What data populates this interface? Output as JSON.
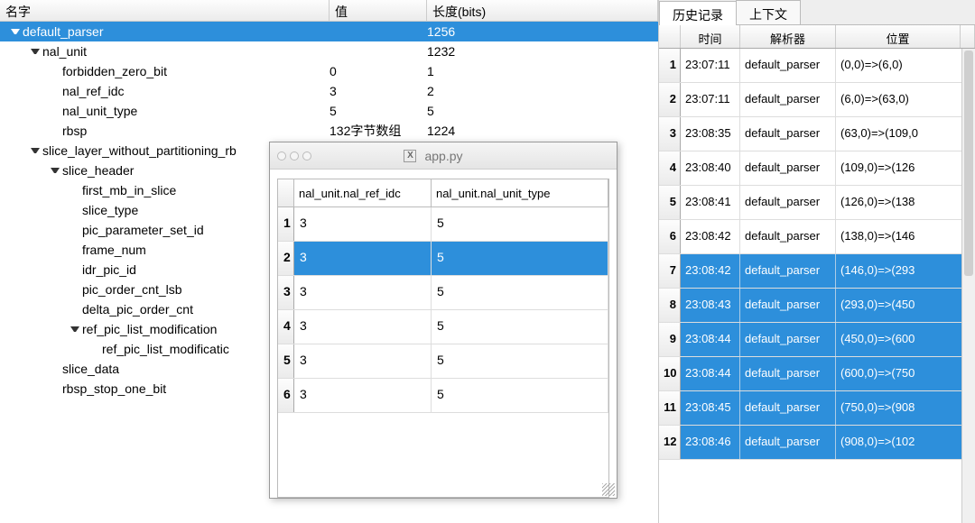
{
  "main_headers": {
    "name": "名字",
    "value": "值",
    "length": "长度(bits)"
  },
  "tree": [
    {
      "indent": 0,
      "arrow": "down",
      "name": "default_parser",
      "value": "",
      "length": "1256",
      "selected": true
    },
    {
      "indent": 1,
      "arrow": "down",
      "name": "nal_unit",
      "value": "",
      "length": "1232"
    },
    {
      "indent": 2,
      "arrow": "",
      "name": "forbidden_zero_bit",
      "value": "0",
      "length": "1"
    },
    {
      "indent": 2,
      "arrow": "",
      "name": "nal_ref_idc",
      "value": "3",
      "length": "2"
    },
    {
      "indent": 2,
      "arrow": "",
      "name": "nal_unit_type",
      "value": "5",
      "length": "5"
    },
    {
      "indent": 2,
      "arrow": "",
      "name": "rbsp",
      "value": "132字节数组",
      "length": "1224"
    },
    {
      "indent": 1,
      "arrow": "down",
      "name": "slice_layer_without_partitioning_rb",
      "value": "",
      "length": ""
    },
    {
      "indent": 2,
      "arrow": "down",
      "name": "slice_header",
      "value": "",
      "length": ""
    },
    {
      "indent": 3,
      "arrow": "",
      "name": "first_mb_in_slice",
      "value": "",
      "length": ""
    },
    {
      "indent": 3,
      "arrow": "",
      "name": "slice_type",
      "value": "",
      "length": ""
    },
    {
      "indent": 3,
      "arrow": "",
      "name": "pic_parameter_set_id",
      "value": "",
      "length": ""
    },
    {
      "indent": 3,
      "arrow": "",
      "name": "frame_num",
      "value": "",
      "length": ""
    },
    {
      "indent": 3,
      "arrow": "",
      "name": "idr_pic_id",
      "value": "",
      "length": ""
    },
    {
      "indent": 3,
      "arrow": "",
      "name": "pic_order_cnt_lsb",
      "value": "",
      "length": ""
    },
    {
      "indent": 3,
      "arrow": "",
      "name": "delta_pic_order_cnt",
      "value": "",
      "length": ""
    },
    {
      "indent": 3,
      "arrow": "down",
      "name": "ref_pic_list_modification",
      "value": "",
      "length": ""
    },
    {
      "indent": 4,
      "arrow": "",
      "name": "ref_pic_list_modificatic",
      "value": "",
      "length": ""
    },
    {
      "indent": 2,
      "arrow": "",
      "name": "slice_data",
      "value": "",
      "length": ""
    },
    {
      "indent": 2,
      "arrow": "",
      "name": "rbsp_stop_one_bit",
      "value": "",
      "length": ""
    }
  ],
  "tabs": {
    "history": "历史记录",
    "context": "上下文"
  },
  "hist_headers": {
    "time": "时间",
    "parser": "解析器",
    "position": "位置"
  },
  "history": [
    {
      "idx": "1",
      "time": "23:07:11",
      "parser": "default_parser",
      "pos": "(0,0)=>(6,0)",
      "selected": false
    },
    {
      "idx": "2",
      "time": "23:07:11",
      "parser": "default_parser",
      "pos": "(6,0)=>(63,0)",
      "selected": false
    },
    {
      "idx": "3",
      "time": "23:08:35",
      "parser": "default_parser",
      "pos": "(63,0)=>(109,0",
      "selected": false
    },
    {
      "idx": "4",
      "time": "23:08:40",
      "parser": "default_parser",
      "pos": "(109,0)=>(126",
      "selected": false
    },
    {
      "idx": "5",
      "time": "23:08:41",
      "parser": "default_parser",
      "pos": "(126,0)=>(138",
      "selected": false
    },
    {
      "idx": "6",
      "time": "23:08:42",
      "parser": "default_parser",
      "pos": "(138,0)=>(146",
      "selected": false
    },
    {
      "idx": "7",
      "time": "23:08:42",
      "parser": "default_parser",
      "pos": "(146,0)=>(293",
      "selected": true
    },
    {
      "idx": "8",
      "time": "23:08:43",
      "parser": "default_parser",
      "pos": "(293,0)=>(450",
      "selected": true
    },
    {
      "idx": "9",
      "time": "23:08:44",
      "parser": "default_parser",
      "pos": "(450,0)=>(600",
      "selected": true
    },
    {
      "idx": "10",
      "time": "23:08:44",
      "parser": "default_parser",
      "pos": "(600,0)=>(750",
      "selected": true
    },
    {
      "idx": "11",
      "time": "23:08:45",
      "parser": "default_parser",
      "pos": "(750,0)=>(908",
      "selected": true
    },
    {
      "idx": "12",
      "time": "23:08:46",
      "parser": "default_parser",
      "pos": "(908,0)=>(102",
      "selected": true
    }
  ],
  "popup": {
    "title": "app.py",
    "header1": "nal_unit.nal_ref_idc",
    "header2": "nal_unit.nal_unit_type",
    "rows": [
      {
        "idx": "1",
        "c1": "3",
        "c2": "5",
        "selected": false
      },
      {
        "idx": "2",
        "c1": "3",
        "c2": "5",
        "selected": true
      },
      {
        "idx": "3",
        "c1": "3",
        "c2": "5",
        "selected": false
      },
      {
        "idx": "4",
        "c1": "3",
        "c2": "5",
        "selected": false
      },
      {
        "idx": "5",
        "c1": "3",
        "c2": "5",
        "selected": false
      },
      {
        "idx": "6",
        "c1": "3",
        "c2": "5",
        "selected": false
      }
    ]
  }
}
